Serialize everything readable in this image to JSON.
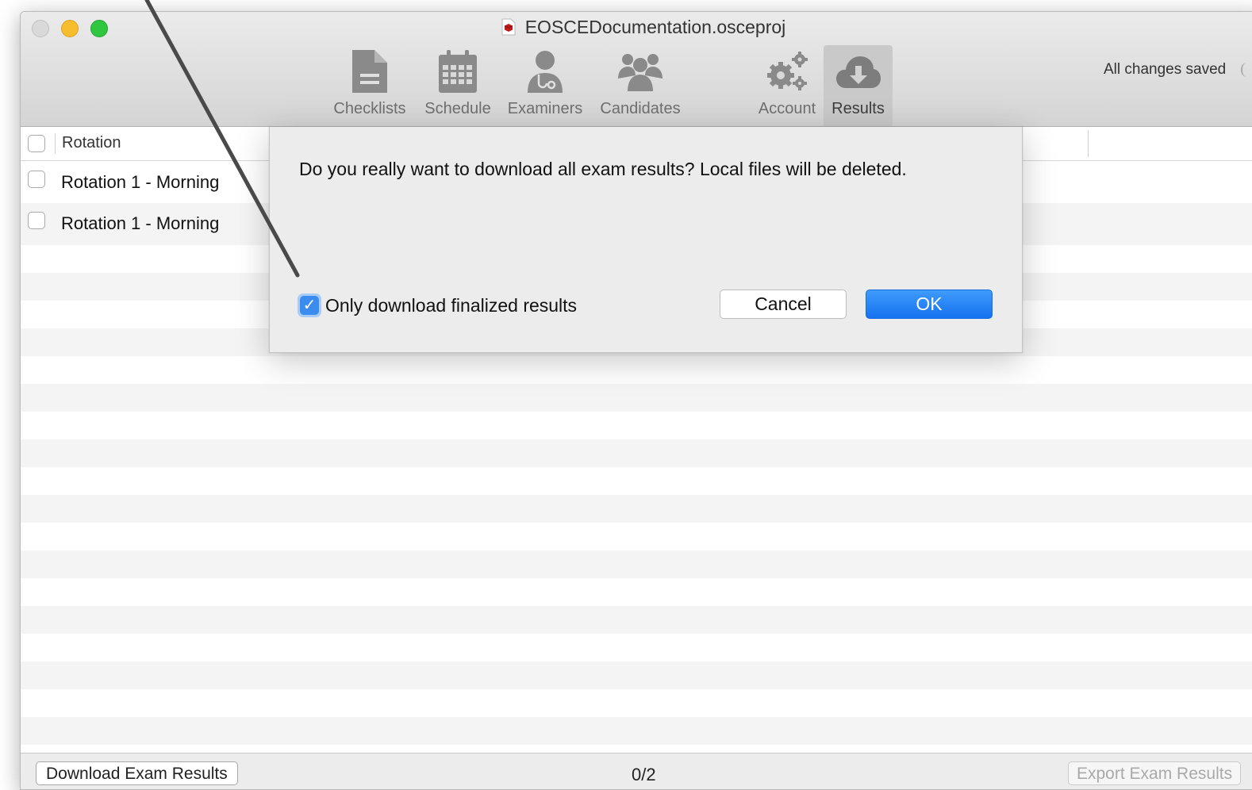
{
  "window": {
    "title": "EOSCEDocumentation.osceproj",
    "status": "All changes saved"
  },
  "toolbar": {
    "items": [
      {
        "label": "Checklists",
        "icon": "document-icon"
      },
      {
        "label": "Schedule",
        "icon": "calendar-icon"
      },
      {
        "label": "Examiners",
        "icon": "doctor-icon"
      },
      {
        "label": "Candidates",
        "icon": "group-icon"
      },
      {
        "label": "Account",
        "icon": "gears-icon"
      },
      {
        "label": "Results",
        "icon": "cloud-download-icon",
        "active": true
      }
    ]
  },
  "table": {
    "column_header": "Rotation",
    "rows": [
      {
        "label": "Rotation 1 - Morning",
        "checked": false
      },
      {
        "label": "Rotation 1 - Morning",
        "checked": false
      }
    ]
  },
  "dialog": {
    "message": "Do you really want to download all exam results? Local files will be deleted.",
    "checkbox_label": "Only download finalized results",
    "checkbox_checked": true,
    "cancel_label": "Cancel",
    "ok_label": "OK"
  },
  "bottom": {
    "download_label": "Download Exam Results",
    "counter": "0/2",
    "export_label": "Export Exam Results"
  },
  "colors": {
    "accent": "#1a78f2",
    "close": "#d9d9d9",
    "minimize": "#f6be2f",
    "maximize": "#2fc640",
    "icon_gray": "#8a8a8a"
  }
}
